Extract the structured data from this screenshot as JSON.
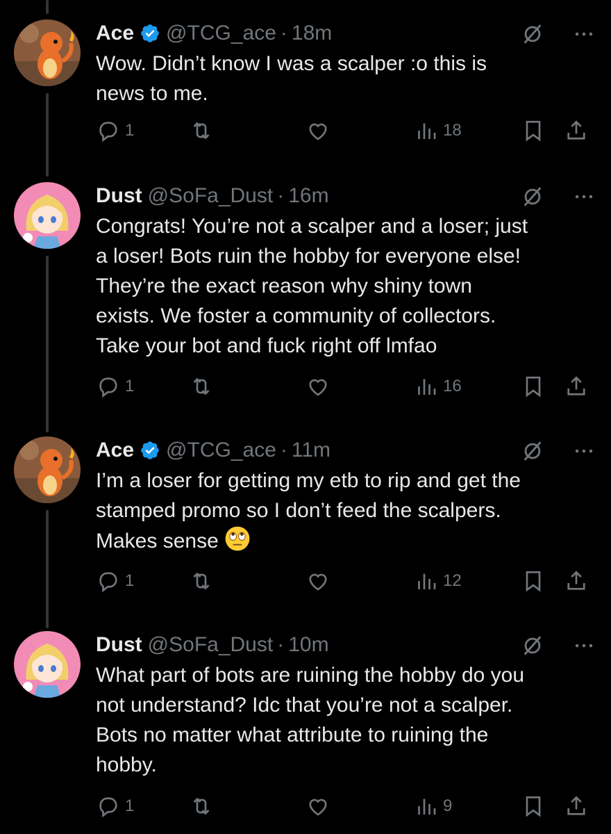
{
  "colors": {
    "background": "#000000",
    "text": "#e7e9ea",
    "muted": "#71767b",
    "verified": "#1d9bf0",
    "thread_line": "#333639"
  },
  "tweets": [
    {
      "name": "Ace",
      "verified": true,
      "handle": "@TCG_ace",
      "separator": "·",
      "time": "18m",
      "text": "Wow. Didn’t know I was a scalper :o this is\nnews to me.",
      "avatar": "charmander-avatar",
      "replies": "1",
      "views": "18"
    },
    {
      "name": "Dust",
      "verified": false,
      "handle": "@SoFa_Dust",
      "separator": "·",
      "time": "16m",
      "text": "Congrats! You’re not a scalper and a loser; just\na loser! Bots ruin the hobby for everyone else!\nThey’re the exact reason why shiny town\nexists. We foster a community of collectors.\nTake your bot and fuck right off lmfao",
      "avatar": "anime-girl-avatar",
      "replies": "1",
      "views": "16"
    },
    {
      "name": "Ace",
      "verified": true,
      "handle": "@TCG_ace",
      "separator": "·",
      "time": "11m",
      "text": "I’m a loser for getting my etb to rip and get the\nstamped promo so I don’t feed the scalpers.\nMakes sense ",
      "emoji": "eye-roll-emoji",
      "avatar": "charmander-avatar",
      "replies": "1",
      "views": "12"
    },
    {
      "name": "Dust",
      "verified": false,
      "handle": "@SoFa_Dust",
      "separator": "·",
      "time": "10m",
      "text": "What part of bots are ruining the hobby do you\nnot understand? Idc that you’re not a scalper.\nBots no matter what attribute to ruining the\nhobby.",
      "avatar": "anime-girl-avatar",
      "replies": "1",
      "views": "9"
    }
  ]
}
